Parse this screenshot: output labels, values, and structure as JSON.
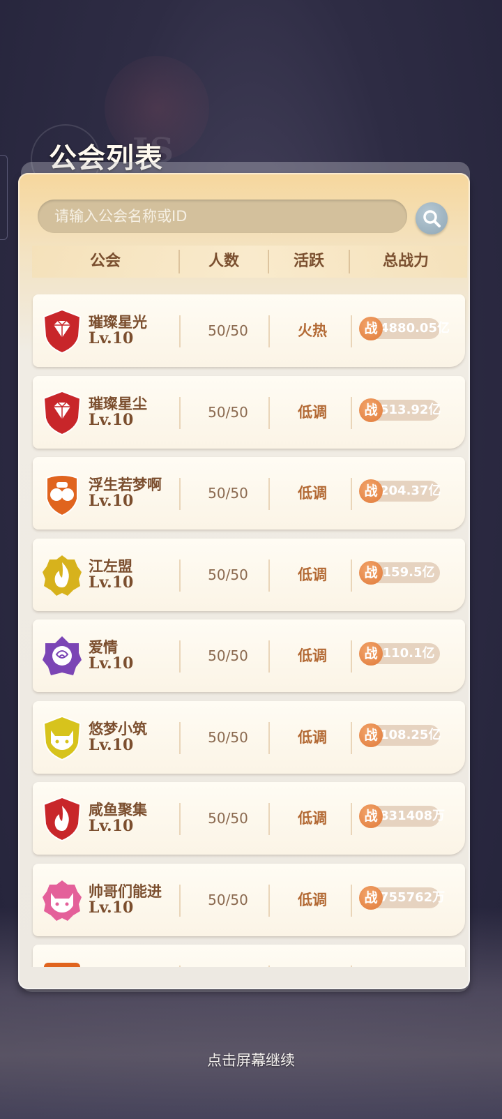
{
  "title": "公会列表",
  "search": {
    "placeholder": "请输入公会名称或ID"
  },
  "columns": [
    "公会",
    "人数",
    "活跃",
    "总战力"
  ],
  "power_badge": "战",
  "guilds": [
    {
      "name": "璀璨星光",
      "level": "Lv.10",
      "members": "50/50",
      "activity": "火热",
      "power": "4880.05亿",
      "emblem": "diamond-shield-icon",
      "color": "#c8262a"
    },
    {
      "name": "璀璨星尘",
      "level": "Lv.10",
      "members": "50/50",
      "activity": "低调",
      "power": "513.92亿",
      "emblem": "diamond-shield-icon",
      "color": "#c8262a"
    },
    {
      "name": "浮生若梦啊",
      "level": "Lv.10",
      "members": "50/50",
      "activity": "低调",
      "power": "204.37亿",
      "emblem": "fist-shield-icon",
      "color": "#e0641e"
    },
    {
      "name": "江左盟",
      "level": "Lv.10",
      "members": "50/50",
      "activity": "低调",
      "power": "159.5亿",
      "emblem": "flame-badge-icon",
      "color": "#d7b21c"
    },
    {
      "name": "爱情",
      "level": "Lv.10",
      "members": "50/50",
      "activity": "低调",
      "power": "110.1亿",
      "emblem": "rose-badge-icon",
      "color": "#7b45b5"
    },
    {
      "name": "悠梦小筑",
      "level": "Lv.10",
      "members": "50/50",
      "activity": "低调",
      "power": "108.25亿",
      "emblem": "cat-shield-icon",
      "color": "#d7c31c"
    },
    {
      "name": "咸鱼聚集",
      "level": "Lv.10",
      "members": "50/50",
      "activity": "低调",
      "power": "831408万",
      "emblem": "flame-shield-icon",
      "color": "#c8262a"
    },
    {
      "name": "帅哥们能进",
      "level": "Lv.10",
      "members": "50/50",
      "activity": "低调",
      "power": "755762万",
      "emblem": "cat-badge-icon",
      "color": "#e4609a"
    },
    {
      "name": "",
      "level": "",
      "members": "",
      "activity": "",
      "power": "",
      "emblem": "orange-badge-icon",
      "color": "#e0641e"
    }
  ],
  "continue_text": "点击屏幕继续"
}
